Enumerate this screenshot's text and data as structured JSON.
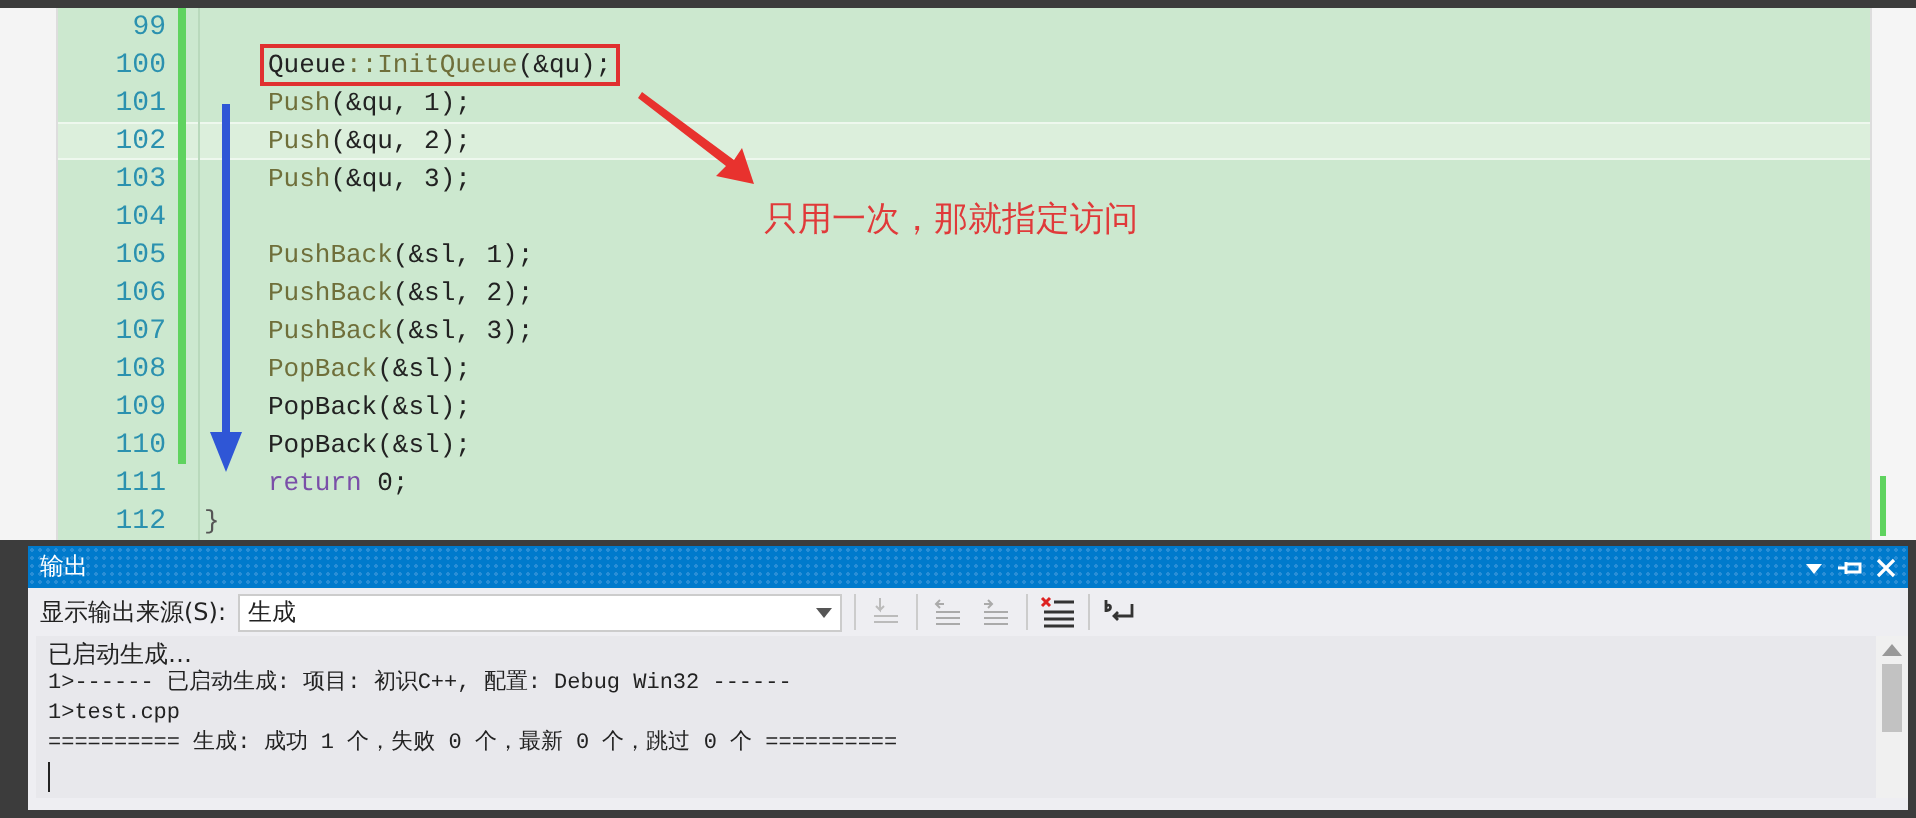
{
  "editor": {
    "lines": [
      {
        "number": "99",
        "changed": true,
        "current": false,
        "boxed": false
      },
      {
        "number": "100",
        "changed": true,
        "current": false,
        "boxed": true,
        "tokens": [
          {
            "text": "Queue",
            "kind": "plain"
          },
          {
            "text": "::InitQueue",
            "kind": "fn"
          },
          {
            "text": "(&qu);",
            "kind": "plain"
          }
        ]
      },
      {
        "number": "101",
        "changed": true,
        "current": false,
        "boxed": false,
        "tokens": [
          {
            "text": "Push",
            "kind": "fn"
          },
          {
            "text": "(&qu, 1);",
            "kind": "plain"
          }
        ]
      },
      {
        "number": "102",
        "changed": true,
        "current": true,
        "boxed": false,
        "tokens": [
          {
            "text": "Push",
            "kind": "fn"
          },
          {
            "text": "(&qu, 2);",
            "kind": "plain"
          }
        ]
      },
      {
        "number": "103",
        "changed": true,
        "current": false,
        "boxed": false,
        "tokens": [
          {
            "text": "Push",
            "kind": "fn"
          },
          {
            "text": "(&qu, 3);",
            "kind": "plain"
          }
        ]
      },
      {
        "number": "104",
        "changed": true,
        "current": false,
        "boxed": false
      },
      {
        "number": "105",
        "changed": true,
        "current": false,
        "boxed": false,
        "tokens": [
          {
            "text": "PushBack",
            "kind": "fn"
          },
          {
            "text": "(&sl, 1);",
            "kind": "plain"
          }
        ]
      },
      {
        "number": "106",
        "changed": true,
        "current": false,
        "boxed": false,
        "tokens": [
          {
            "text": "PushBack",
            "kind": "fn"
          },
          {
            "text": "(&sl, 2);",
            "kind": "plain"
          }
        ]
      },
      {
        "number": "107",
        "changed": true,
        "current": false,
        "boxed": false,
        "tokens": [
          {
            "text": "PushBack",
            "kind": "fn"
          },
          {
            "text": "(&sl, 3);",
            "kind": "plain"
          }
        ]
      },
      {
        "number": "108",
        "changed": true,
        "current": false,
        "boxed": false,
        "tokens": [
          {
            "text": "PopBack",
            "kind": "fn"
          },
          {
            "text": "(&sl);",
            "kind": "plain"
          }
        ]
      },
      {
        "number": "109",
        "changed": true,
        "current": false,
        "boxed": false,
        "tokens": [
          {
            "text": "PopBack(&sl);",
            "kind": "plain"
          }
        ]
      },
      {
        "number": "110",
        "changed": true,
        "current": false,
        "boxed": false,
        "tokens": [
          {
            "text": "PopBack(&sl);",
            "kind": "plain"
          }
        ]
      },
      {
        "number": "111",
        "changed": false,
        "current": false,
        "boxed": false,
        "tokens": [
          {
            "text": "return",
            "kind": "kw"
          },
          {
            "text": " 0;",
            "kind": "plain"
          }
        ]
      },
      {
        "number": "112",
        "changed": false,
        "current": false,
        "boxed": false,
        "tokens": [
          {
            "text": "}",
            "kind": "brace"
          }
        ]
      }
    ],
    "annotation": {
      "text": "只用一次，那就指定访问"
    }
  },
  "output": {
    "title": "输出",
    "source_label": "显示输出来源(S):",
    "source_value": "生成",
    "lines": [
      "已启动生成…",
      "1>------ 已启动生成: 项目: 初识C++, 配置: Debug Win32 ------",
      "1>test.cpp",
      "========== 生成: 成功 1 个，失败 0 个，最新 0 个，跳过 0 个 =========="
    ]
  }
}
